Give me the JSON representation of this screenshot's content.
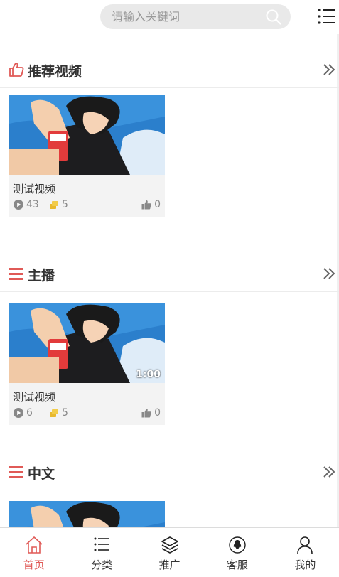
{
  "search": {
    "placeholder": "请输入关键词"
  },
  "sections": [
    {
      "title": "推荐视频",
      "icon": "thumbs-up-icon",
      "card": {
        "title": "测试视频",
        "views": "43",
        "coins": "5",
        "likes": "0",
        "duration": ""
      }
    },
    {
      "title": "主播",
      "icon": "list-icon",
      "card": {
        "title": "测试视频",
        "views": "6",
        "coins": "5",
        "likes": "0",
        "duration": "1:00"
      }
    },
    {
      "title": "中文",
      "icon": "list-icon",
      "card": {
        "title": "",
        "views": "",
        "coins": "",
        "likes": "",
        "duration": ""
      }
    }
  ],
  "tabs": [
    {
      "label": "首页",
      "icon": "home-icon",
      "active": true
    },
    {
      "label": "分类",
      "icon": "category-list-icon",
      "active": false
    },
    {
      "label": "推广",
      "icon": "layers-icon",
      "active": false
    },
    {
      "label": "客服",
      "icon": "qq-icon",
      "active": false
    },
    {
      "label": "我的",
      "icon": "user-icon",
      "active": false
    }
  ],
  "colors": {
    "accent": "#e05a57",
    "coin": "#e8b92e",
    "gray": "#888888"
  }
}
